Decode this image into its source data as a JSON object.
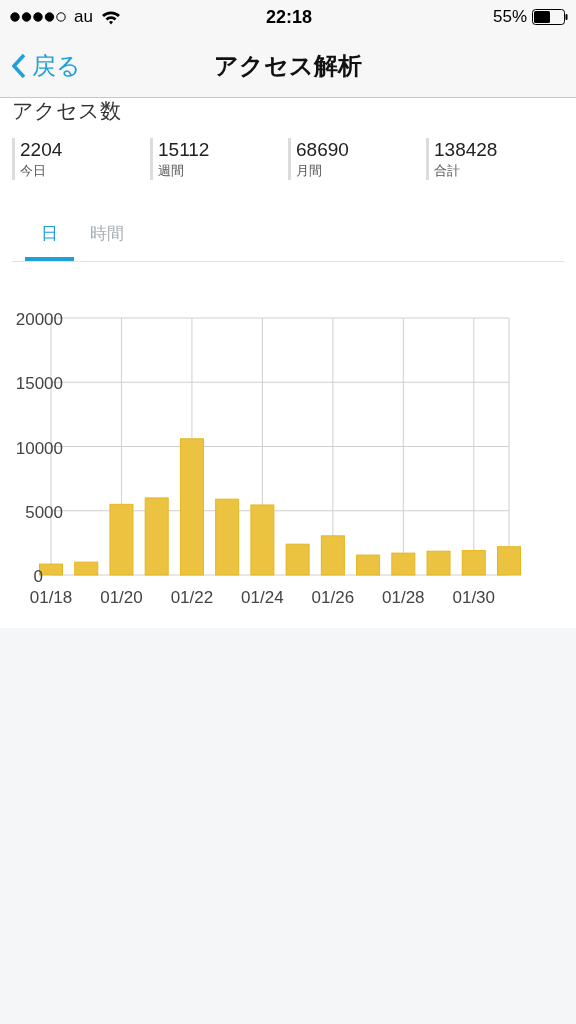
{
  "status_bar": {
    "carrier": "au",
    "time": "22:18",
    "battery": "55%"
  },
  "nav": {
    "back": "戻る",
    "title": "アクセス解析"
  },
  "section_title": "アクセス数",
  "stats": [
    {
      "value": "2204",
      "label": "今日"
    },
    {
      "value": "15112",
      "label": "週間"
    },
    {
      "value": "68690",
      "label": "月間"
    },
    {
      "value": "138428",
      "label": "合計"
    }
  ],
  "tabs": [
    {
      "label": "日",
      "selected": true
    },
    {
      "label": "時間",
      "selected": false
    }
  ],
  "chart": {
    "chart_data": {
      "type": "bar",
      "categories": [
        "01/18",
        null,
        "01/20",
        null,
        "01/22",
        null,
        "01/24",
        null,
        "01/26",
        null,
        "01/28",
        null,
        "01/30",
        null
      ],
      "series": [
        {
          "color": "#ecc241",
          "values": [
            850,
            1000,
            5500,
            6000,
            10600,
            5900,
            5450,
            2400,
            3050,
            1550,
            1700,
            1850,
            1900,
            2200
          ]
        }
      ],
      "ylim": [
        0,
        20000
      ],
      "yticks": [
        0,
        5000,
        10000,
        15000,
        20000
      ],
      "grid": true
    }
  }
}
